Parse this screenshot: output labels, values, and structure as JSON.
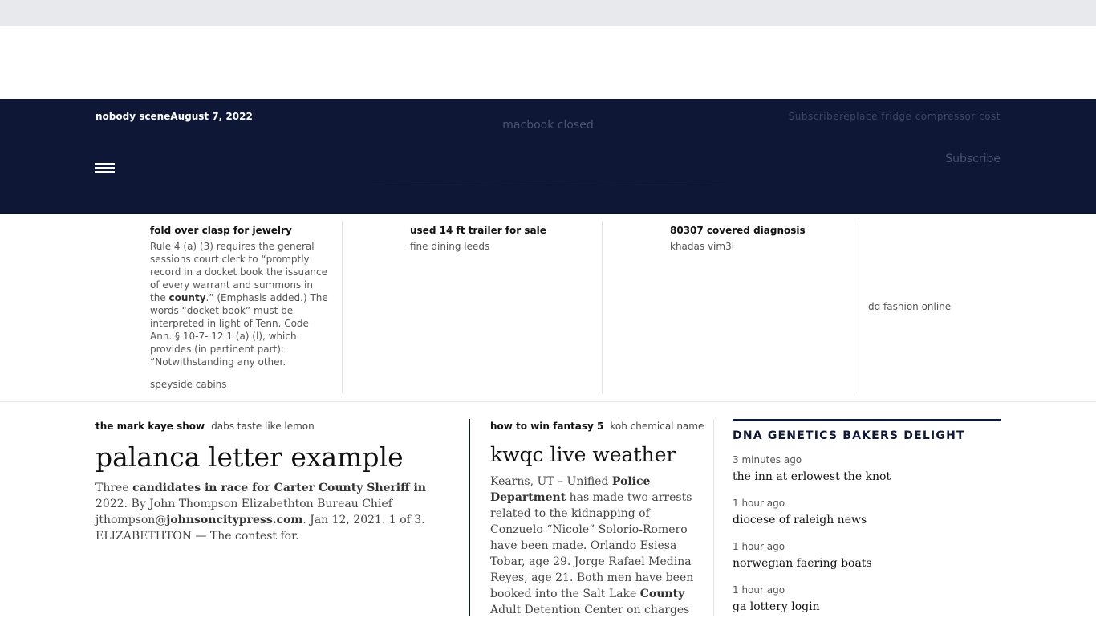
{
  "masthead": {
    "left_text": "nobody sceneAugust 7, 2022",
    "center_text": "macbook closed",
    "right_text": "Subscribereplace fridge compressor cost",
    "subscribe_label": "Subscribe",
    "menu_icon": "hamburger-icon"
  },
  "ticker": [
    {
      "title": "fold over clasp for jewelry",
      "text_parts": [
        "Rule 4 (a) (3) requires the general sessions court clerk to “promptly record in a docket book the issuance of every warrant and summons in the ",
        "county",
        ".” (Emphasis added.) The words “docket book” must be interpreted in light of Tenn. Code Ann. § 10-7- 12 1 (a) (l), which provides (in pertinent part): “Notwithstanding any other."
      ],
      "sub": "speyside cabins"
    },
    {
      "title": "used 14 ft trailer for sale",
      "sub": "fine dining leeds"
    },
    {
      "title": "80307 covered diagnosis",
      "sub": "khadas vim3l"
    },
    {
      "link": "dd fashion online"
    }
  ],
  "article1": {
    "category": "the mark kaye show",
    "tag": "dabs taste like lemon",
    "headline": "palanca letter example",
    "body_parts": [
      "Three ",
      "candidates in race for Carter County Sheriff in",
      " 2022. By John Thompson Elizabethton Bureau Chief jthompson@",
      "johnsoncitypress.com",
      ". Jan 12, 2021. 1 of 3. ELIZABETHTON — The contest for."
    ]
  },
  "article2": {
    "category": "how to win fantasy 5",
    "tag": "koh chemical name",
    "headline": "kwqc live weather",
    "body_parts": [
      "Kearns, UT – Unified ",
      "Police Department",
      " has made two arrests related to the kidnapping of Conzuelo “Nicole” Solorio-Romero have been made. Orlando Esiesa Tobar, age 29. Jorge Rafael Medina Reyes, age 21. Both men have been booked into the Salt Lake ",
      "County",
      " Adult Detention Center on charges"
    ]
  },
  "sidebar": {
    "title": "DNA GENETICS BAKERS DELIGHT",
    "items": [
      {
        "time": "3 minutes ago",
        "label": "the inn at erlowest the knot"
      },
      {
        "time": "1 hour ago",
        "label": "diocese of raleigh news"
      },
      {
        "time": "1 hour ago",
        "label": "norwegian faering boats"
      },
      {
        "time": "1 hour ago",
        "label": "ga lottery login"
      }
    ]
  },
  "colors": {
    "masthead_bg": "#0e1836",
    "top_strip_bg": "#e8e9ec",
    "accent": "#0e1836"
  }
}
